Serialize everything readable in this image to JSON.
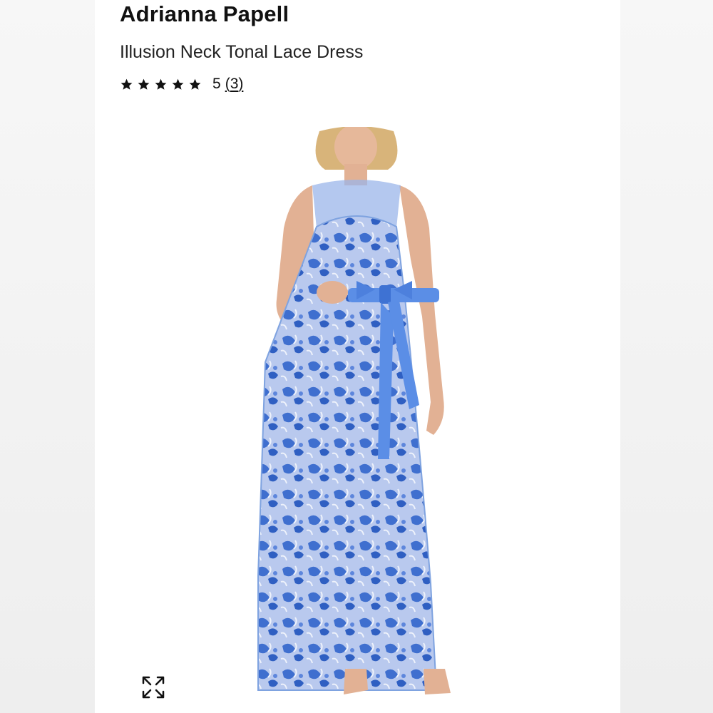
{
  "product": {
    "brand": "Adrianna Papell",
    "name": "Illusion Neck Tonal Lace Dress",
    "rating_value": "5",
    "rating_count_open": "(",
    "rating_count": "3",
    "rating_count_close": ")",
    "stars": 5
  },
  "image": {
    "alt": "Model wearing blue lace sleeveless maxi dress with satin bow belt",
    "dress_color": "#7fa3e0",
    "ribbon_color": "#5b8ee6"
  },
  "controls": {
    "expand_icon": "expand-arrows-icon"
  }
}
